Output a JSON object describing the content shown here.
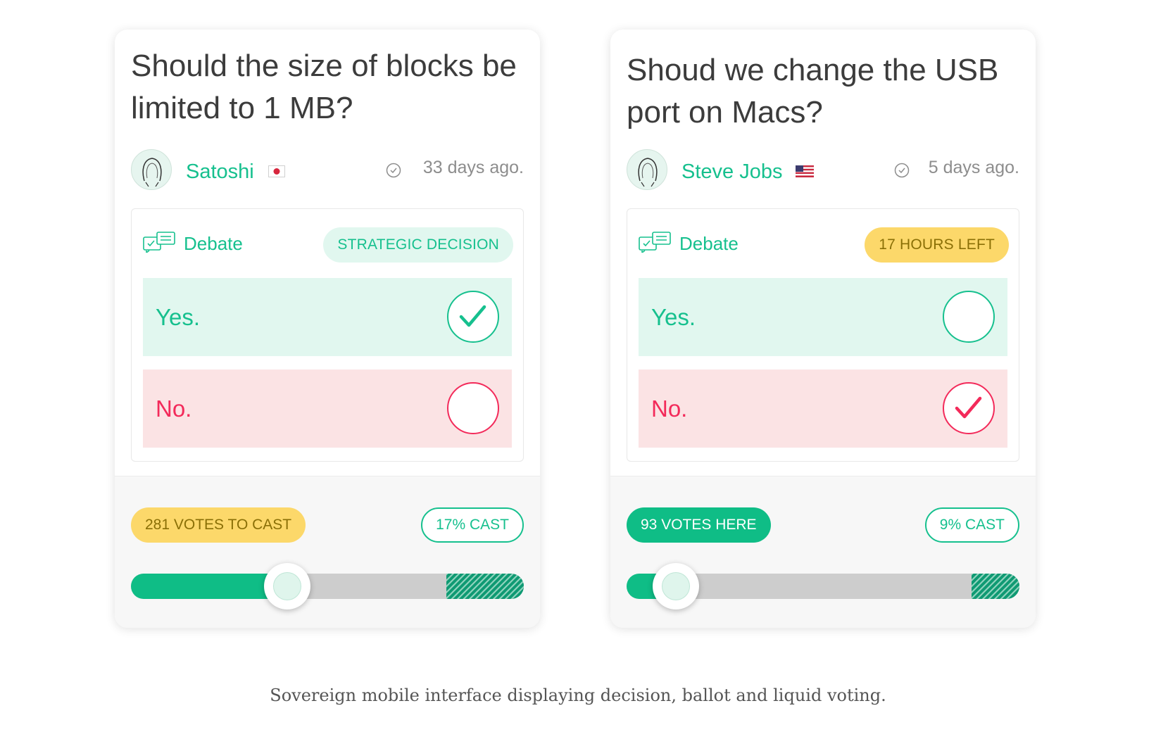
{
  "cards": [
    {
      "title": "Should the size of blocks be limited to 1 MB?",
      "author": "Satoshi",
      "flag": "japan-flag-icon",
      "time_ago": "33 days ago.",
      "debate_label": "Debate",
      "badge": "STRATEGIC DECISION",
      "options": [
        {
          "label": "Yes.",
          "checked": true
        },
        {
          "label": "No.",
          "checked": false
        }
      ],
      "votes_pill": "281 VOTES TO CAST",
      "cast_pill": "17% CAST",
      "slider_fraction": 0.415
    },
    {
      "title": "Shoud we change the USB port on Macs?",
      "author": "Steve Jobs",
      "flag": "usa-flag-icon",
      "time_ago": "5 days ago.",
      "debate_label": "Debate",
      "badge": "17 HOURS LEFT",
      "options": [
        {
          "label": "Yes.",
          "checked": false
        },
        {
          "label": "No.",
          "checked": true
        }
      ],
      "votes_pill": "93 VOTES HERE",
      "cast_pill": "9% CAST",
      "slider_fraction": 0.125
    }
  ],
  "caption": "Sovereign mobile interface displaying decision, ballot and liquid voting.",
  "colors": {
    "accent_green": "#16c08e",
    "accent_red": "#f32a5a",
    "yellow": "#fcd86a",
    "yes_bg": "#e1f7ef",
    "no_bg": "#fbe3e4"
  }
}
